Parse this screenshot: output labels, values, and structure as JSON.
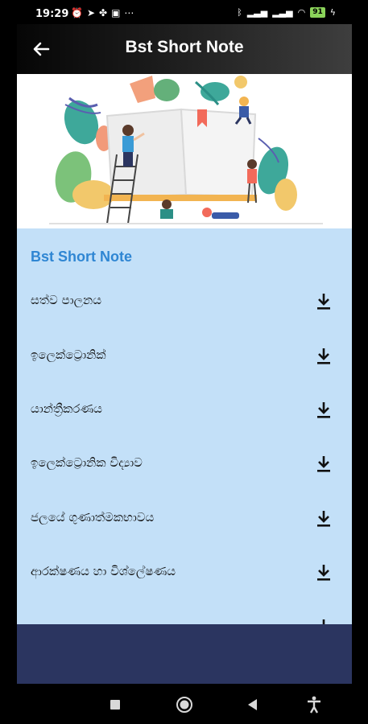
{
  "status_bar": {
    "time": "19:29",
    "battery": "91",
    "left_icons": [
      "alarm-icon",
      "telegram-icon",
      "game-icon",
      "app-icon",
      "more-icon"
    ],
    "right_icons": [
      "bluetooth-icon",
      "signal-icon",
      "signal-icon",
      "wifi-icon",
      "battery-icon",
      "charging-icon"
    ]
  },
  "app_bar": {
    "title": "Bst Short Note",
    "back_icon": "arrow-back-icon"
  },
  "list": {
    "section_title": "Bst Short Note",
    "items": [
      {
        "label": "සත්ව පාලනය",
        "icon": "download-icon"
      },
      {
        "label": "ඉලෙක්ට්‍රොනික්",
        "icon": "download-icon"
      },
      {
        "label": "යාන්ත්‍රීකරණය",
        "icon": "download-icon"
      },
      {
        "label": "ඉලෙක්ට්‍රොනික විද්‍යාව",
        "icon": "download-icon"
      },
      {
        "label": "ජලයේ ගුණාත්මකභාවය",
        "icon": "download-icon"
      },
      {
        "label": " ආරක්ෂණය හා විශ්ලේෂණය",
        "icon": "download-icon"
      }
    ]
  },
  "colors": {
    "list_background": "#c3e0f8",
    "section_title": "#2f86d3",
    "bottom_panel": "#2b3560"
  }
}
